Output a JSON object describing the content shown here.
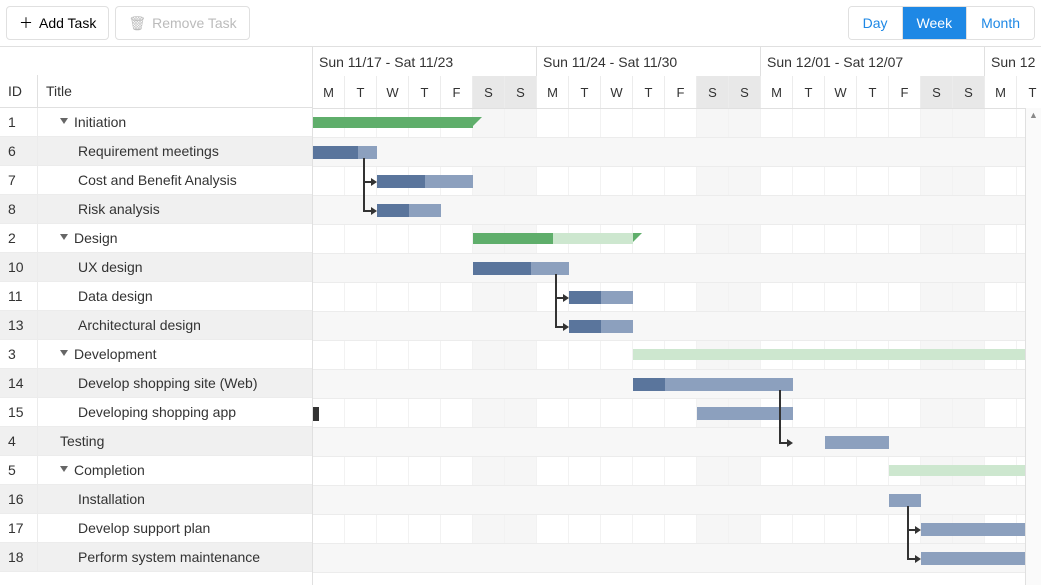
{
  "dayWidth": 32,
  "offsetDays": -5,
  "toolbar": {
    "add_label": "Add Task",
    "remove_label": "Remove Task"
  },
  "view_toggle": {
    "day": "Day",
    "week": "Week",
    "month": "Month",
    "active": "Week"
  },
  "columns": {
    "id": "ID",
    "title": "Title"
  },
  "timeline": {
    "weeks": [
      {
        "label": "Sun 11/17 - Sat 11/23",
        "startDay": 5
      },
      {
        "label": "Sun 11/24 - Sat 11/30",
        "startDay": 12
      },
      {
        "label": "Sun 12/01 - Sat 12/07",
        "startDay": 19
      },
      {
        "label": "Sun 12",
        "startDay": 26
      }
    ],
    "dayLetters": [
      "M",
      "T",
      "W",
      "T",
      "F",
      "S",
      "S",
      "M",
      "T",
      "W",
      "T",
      "F",
      "S",
      "S",
      "M",
      "T",
      "W",
      "T",
      "F",
      "S",
      "S",
      "M",
      "T"
    ],
    "weekendIndices": [
      5,
      6,
      12,
      13,
      19,
      20
    ]
  },
  "tasks": [
    {
      "rowId": 1,
      "title": "Initiation",
      "level": 1,
      "summary": true,
      "expanded": true,
      "sumStart": 0,
      "sumEnd": 5,
      "progress": 1.0,
      "shade": false
    },
    {
      "rowId": 6,
      "title": "Requirement meetings",
      "level": 2,
      "start": 0,
      "end": 2,
      "progress": 0.7,
      "shade": true
    },
    {
      "rowId": 7,
      "title": "Cost and Benefit Analysis",
      "level": 2,
      "start": 2,
      "end": 5,
      "progress": 0.5,
      "shade": false
    },
    {
      "rowId": 8,
      "title": "Risk analysis",
      "level": 2,
      "start": 2,
      "end": 4,
      "progress": 0.5,
      "shade": true
    },
    {
      "rowId": 2,
      "title": "Design",
      "level": 1,
      "summary": true,
      "expanded": true,
      "sumStart": 5,
      "sumEnd": 10,
      "progress": 0.5,
      "shade": false
    },
    {
      "rowId": 10,
      "title": "UX design",
      "level": 2,
      "start": 5,
      "end": 8,
      "progress": 0.6,
      "shade": true
    },
    {
      "rowId": 11,
      "title": "Data design",
      "level": 2,
      "start": 8,
      "end": 10,
      "progress": 0.5,
      "shade": false
    },
    {
      "rowId": 13,
      "title": "Architectural design",
      "level": 2,
      "start": 8,
      "end": 10,
      "progress": 0.5,
      "shade": true
    },
    {
      "rowId": 3,
      "title": "Development",
      "level": 1,
      "summary": true,
      "expanded": true,
      "sumStart": 10,
      "sumEnd": 28,
      "progress": 0.0,
      "shade": false,
      "light": true
    },
    {
      "rowId": 14,
      "title": "Develop shopping site (Web)",
      "level": 2,
      "start": 10,
      "end": 15,
      "progress": 0.2,
      "shade": true
    },
    {
      "rowId": 15,
      "title": "Developing shopping app",
      "level": 2,
      "start": 12,
      "end": 15,
      "progress": 0.0,
      "shade": false,
      "milestoneAt": 0
    },
    {
      "rowId": 4,
      "title": "Testing",
      "level": 1,
      "start": 16,
      "end": 18,
      "progress": 0.0,
      "shade": true
    },
    {
      "rowId": 5,
      "title": "Completion",
      "level": 1,
      "summary": true,
      "expanded": true,
      "sumStart": 18,
      "sumEnd": 28,
      "progress": 0.0,
      "shade": false,
      "light": true
    },
    {
      "rowId": 16,
      "title": "Installation",
      "level": 2,
      "start": 18,
      "end": 19,
      "progress": 0.0,
      "shade": true
    },
    {
      "rowId": 17,
      "title": "Develop support plan",
      "level": 2,
      "start": 19,
      "end": 24,
      "progress": 0.0,
      "shade": false
    },
    {
      "rowId": 18,
      "title": "Perform system maintenance",
      "level": 2,
      "start": 19,
      "end": 24,
      "progress": 0.0,
      "shade": true
    }
  ],
  "dependencies": [
    {
      "fromRow": 1,
      "toRow": 2,
      "xDay": 2
    },
    {
      "fromRow": 1,
      "toRow": 3,
      "xDay": 2
    },
    {
      "fromRow": 5,
      "toRow": 6,
      "xDay": 8
    },
    {
      "fromRow": 5,
      "toRow": 7,
      "xDay": 8
    },
    {
      "fromRow": 9,
      "toRow": 11,
      "xDay": 15
    },
    {
      "fromRow": 13,
      "toRow": 14,
      "xDay": 19
    },
    {
      "fromRow": 13,
      "toRow": 15,
      "xDay": 19
    }
  ],
  "chart_data": {
    "type": "gantt",
    "dateOrigin": "2024-11-17",
    "unit": "days since 2024-11-17 (Sun)",
    "tasks": [
      {
        "id": 1,
        "title": "Initiation",
        "type": "summary",
        "start": 1,
        "end": 5,
        "progress": 1.0
      },
      {
        "id": 6,
        "title": "Requirement meetings",
        "type": "task",
        "parent": 1,
        "start": 1,
        "end": 2,
        "progress": 0.7
      },
      {
        "id": 7,
        "title": "Cost and Benefit Analysis",
        "type": "task",
        "parent": 1,
        "start": 2,
        "end": 5,
        "progress": 0.5
      },
      {
        "id": 8,
        "title": "Risk analysis",
        "type": "task",
        "parent": 1,
        "start": 2,
        "end": 4,
        "progress": 0.5
      },
      {
        "id": 2,
        "title": "Design",
        "type": "summary",
        "start": 5,
        "end": 10,
        "progress": 0.5
      },
      {
        "id": 10,
        "title": "UX design",
        "type": "task",
        "parent": 2,
        "start": 5,
        "end": 8,
        "progress": 0.6
      },
      {
        "id": 11,
        "title": "Data design",
        "type": "task",
        "parent": 2,
        "start": 8,
        "end": 10,
        "progress": 0.5
      },
      {
        "id": 13,
        "title": "Architectural design",
        "type": "task",
        "parent": 2,
        "start": 8,
        "end": 10,
        "progress": 0.5
      },
      {
        "id": 3,
        "title": "Development",
        "type": "summary",
        "start": 10,
        "end": 28,
        "progress": 0.0
      },
      {
        "id": 14,
        "title": "Develop shopping site (Web)",
        "type": "task",
        "parent": 3,
        "start": 10,
        "end": 15,
        "progress": 0.2
      },
      {
        "id": 15,
        "title": "Developing shopping app",
        "type": "task",
        "parent": 3,
        "start": 12,
        "end": 15,
        "progress": 0.0
      },
      {
        "id": 4,
        "title": "Testing",
        "type": "task",
        "start": 16,
        "end": 18,
        "progress": 0.0
      },
      {
        "id": 5,
        "title": "Completion",
        "type": "summary",
        "start": 18,
        "end": 28,
        "progress": 0.0
      },
      {
        "id": 16,
        "title": "Installation",
        "type": "task",
        "parent": 5,
        "start": 18,
        "end": 19,
        "progress": 0.0
      },
      {
        "id": 17,
        "title": "Develop support plan",
        "type": "task",
        "parent": 5,
        "start": 19,
        "end": 24,
        "progress": 0.0
      },
      {
        "id": 18,
        "title": "Perform system maintenance",
        "type": "task",
        "parent": 5,
        "start": 19,
        "end": 24,
        "progress": 0.0
      }
    ],
    "dependencies": [
      {
        "from": 6,
        "to": 7
      },
      {
        "from": 6,
        "to": 8
      },
      {
        "from": 10,
        "to": 11
      },
      {
        "from": 10,
        "to": 13
      },
      {
        "from": 14,
        "to": 4
      },
      {
        "from": 15,
        "to": 4
      },
      {
        "from": 16,
        "to": 17
      },
      {
        "from": 16,
        "to": 18
      }
    ]
  }
}
